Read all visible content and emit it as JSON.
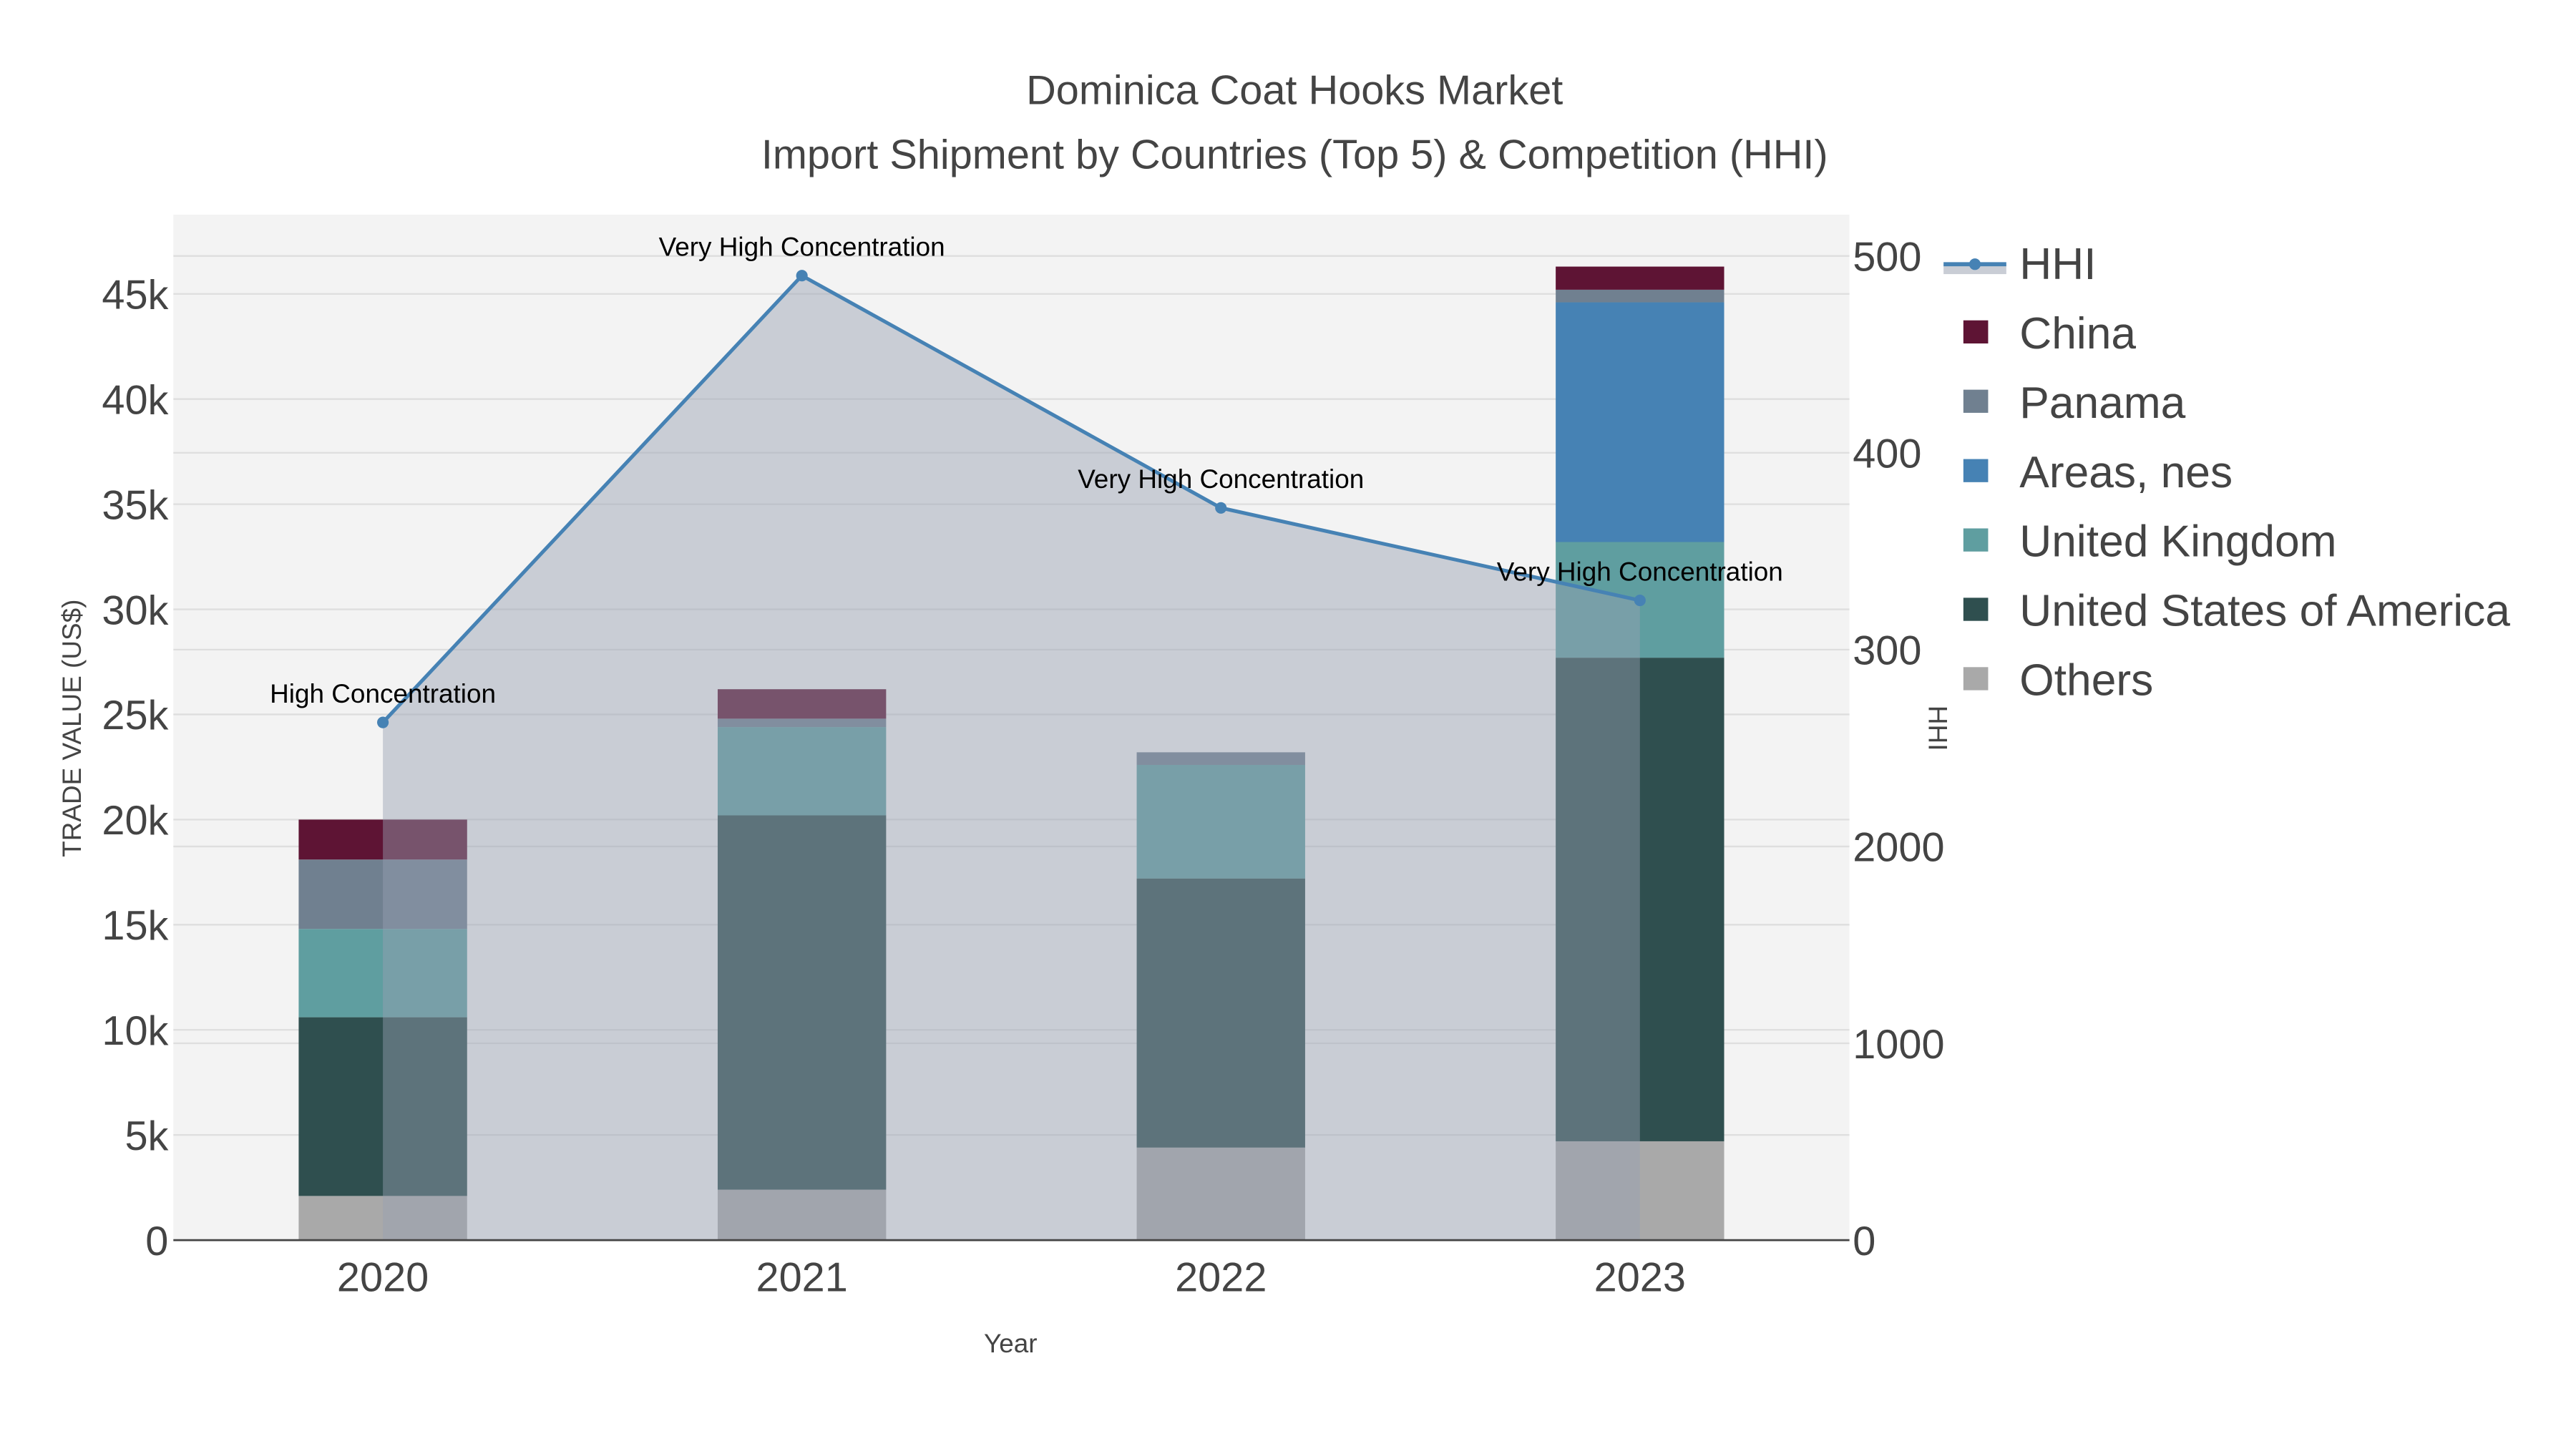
{
  "chart_data": {
    "type": "bar",
    "title": "Dominica Coat Hooks Market",
    "subtitle": "Import Shipment by Countries (Top 5) & Competition (HHI)",
    "xlabel": "Year",
    "ylabel": "TRADE VALUE (US$)",
    "y2label": "HHI",
    "categories": [
      "2020",
      "2021",
      "2022",
      "2023"
    ],
    "ylim": [
      0,
      48500
    ],
    "y_ticks": [
      0,
      5000,
      10000,
      15000,
      20000,
      25000,
      30000,
      35000,
      40000,
      45000
    ],
    "y_tick_labels": [
      "0",
      "5k",
      "10k",
      "15k",
      "20k",
      "25k",
      "30k",
      "35k",
      "40k",
      "45k"
    ],
    "y2lim": [
      0,
      5200
    ],
    "y2_ticks": [
      0,
      1000,
      2000,
      3000,
      4000,
      5000
    ],
    "y2_tick_labels": [
      "0",
      "1000",
      "2000",
      "300",
      "400",
      "500"
    ],
    "stacked": true,
    "series": [
      {
        "name": "Others",
        "color": "#a9a9a9",
        "values": [
          2100,
          2400,
          4400,
          4700
        ]
      },
      {
        "name": "United States of America",
        "color": "#2f4f4f",
        "values": [
          8500,
          17800,
          12800,
          23000
        ]
      },
      {
        "name": "United Kingdom",
        "color": "#5f9ea0",
        "values": [
          4200,
          4200,
          5400,
          5500
        ]
      },
      {
        "name": "Areas, nes",
        "color": "#4682b4",
        "values": [
          0,
          0,
          0,
          11400
        ]
      },
      {
        "name": "Panama",
        "color": "#708090",
        "values": [
          3300,
          400,
          600,
          600
        ]
      },
      {
        "name": "China",
        "color": "#5e1434",
        "values": [
          1900,
          1400,
          0,
          1100
        ]
      }
    ],
    "hhi": {
      "name": "HHI",
      "color": "#4682b4",
      "values": [
        2630,
        4900,
        3720,
        3250
      ],
      "annotations": [
        "High Concentration",
        "Very High Concentration",
        "Very High Concentration",
        "Very High Concentration"
      ]
    },
    "legend": [
      "HHI",
      "China",
      "Panama",
      "Areas, nes",
      "United Kingdom",
      "United States of America",
      "Others"
    ],
    "legend_placement": "right",
    "grid": true
  }
}
